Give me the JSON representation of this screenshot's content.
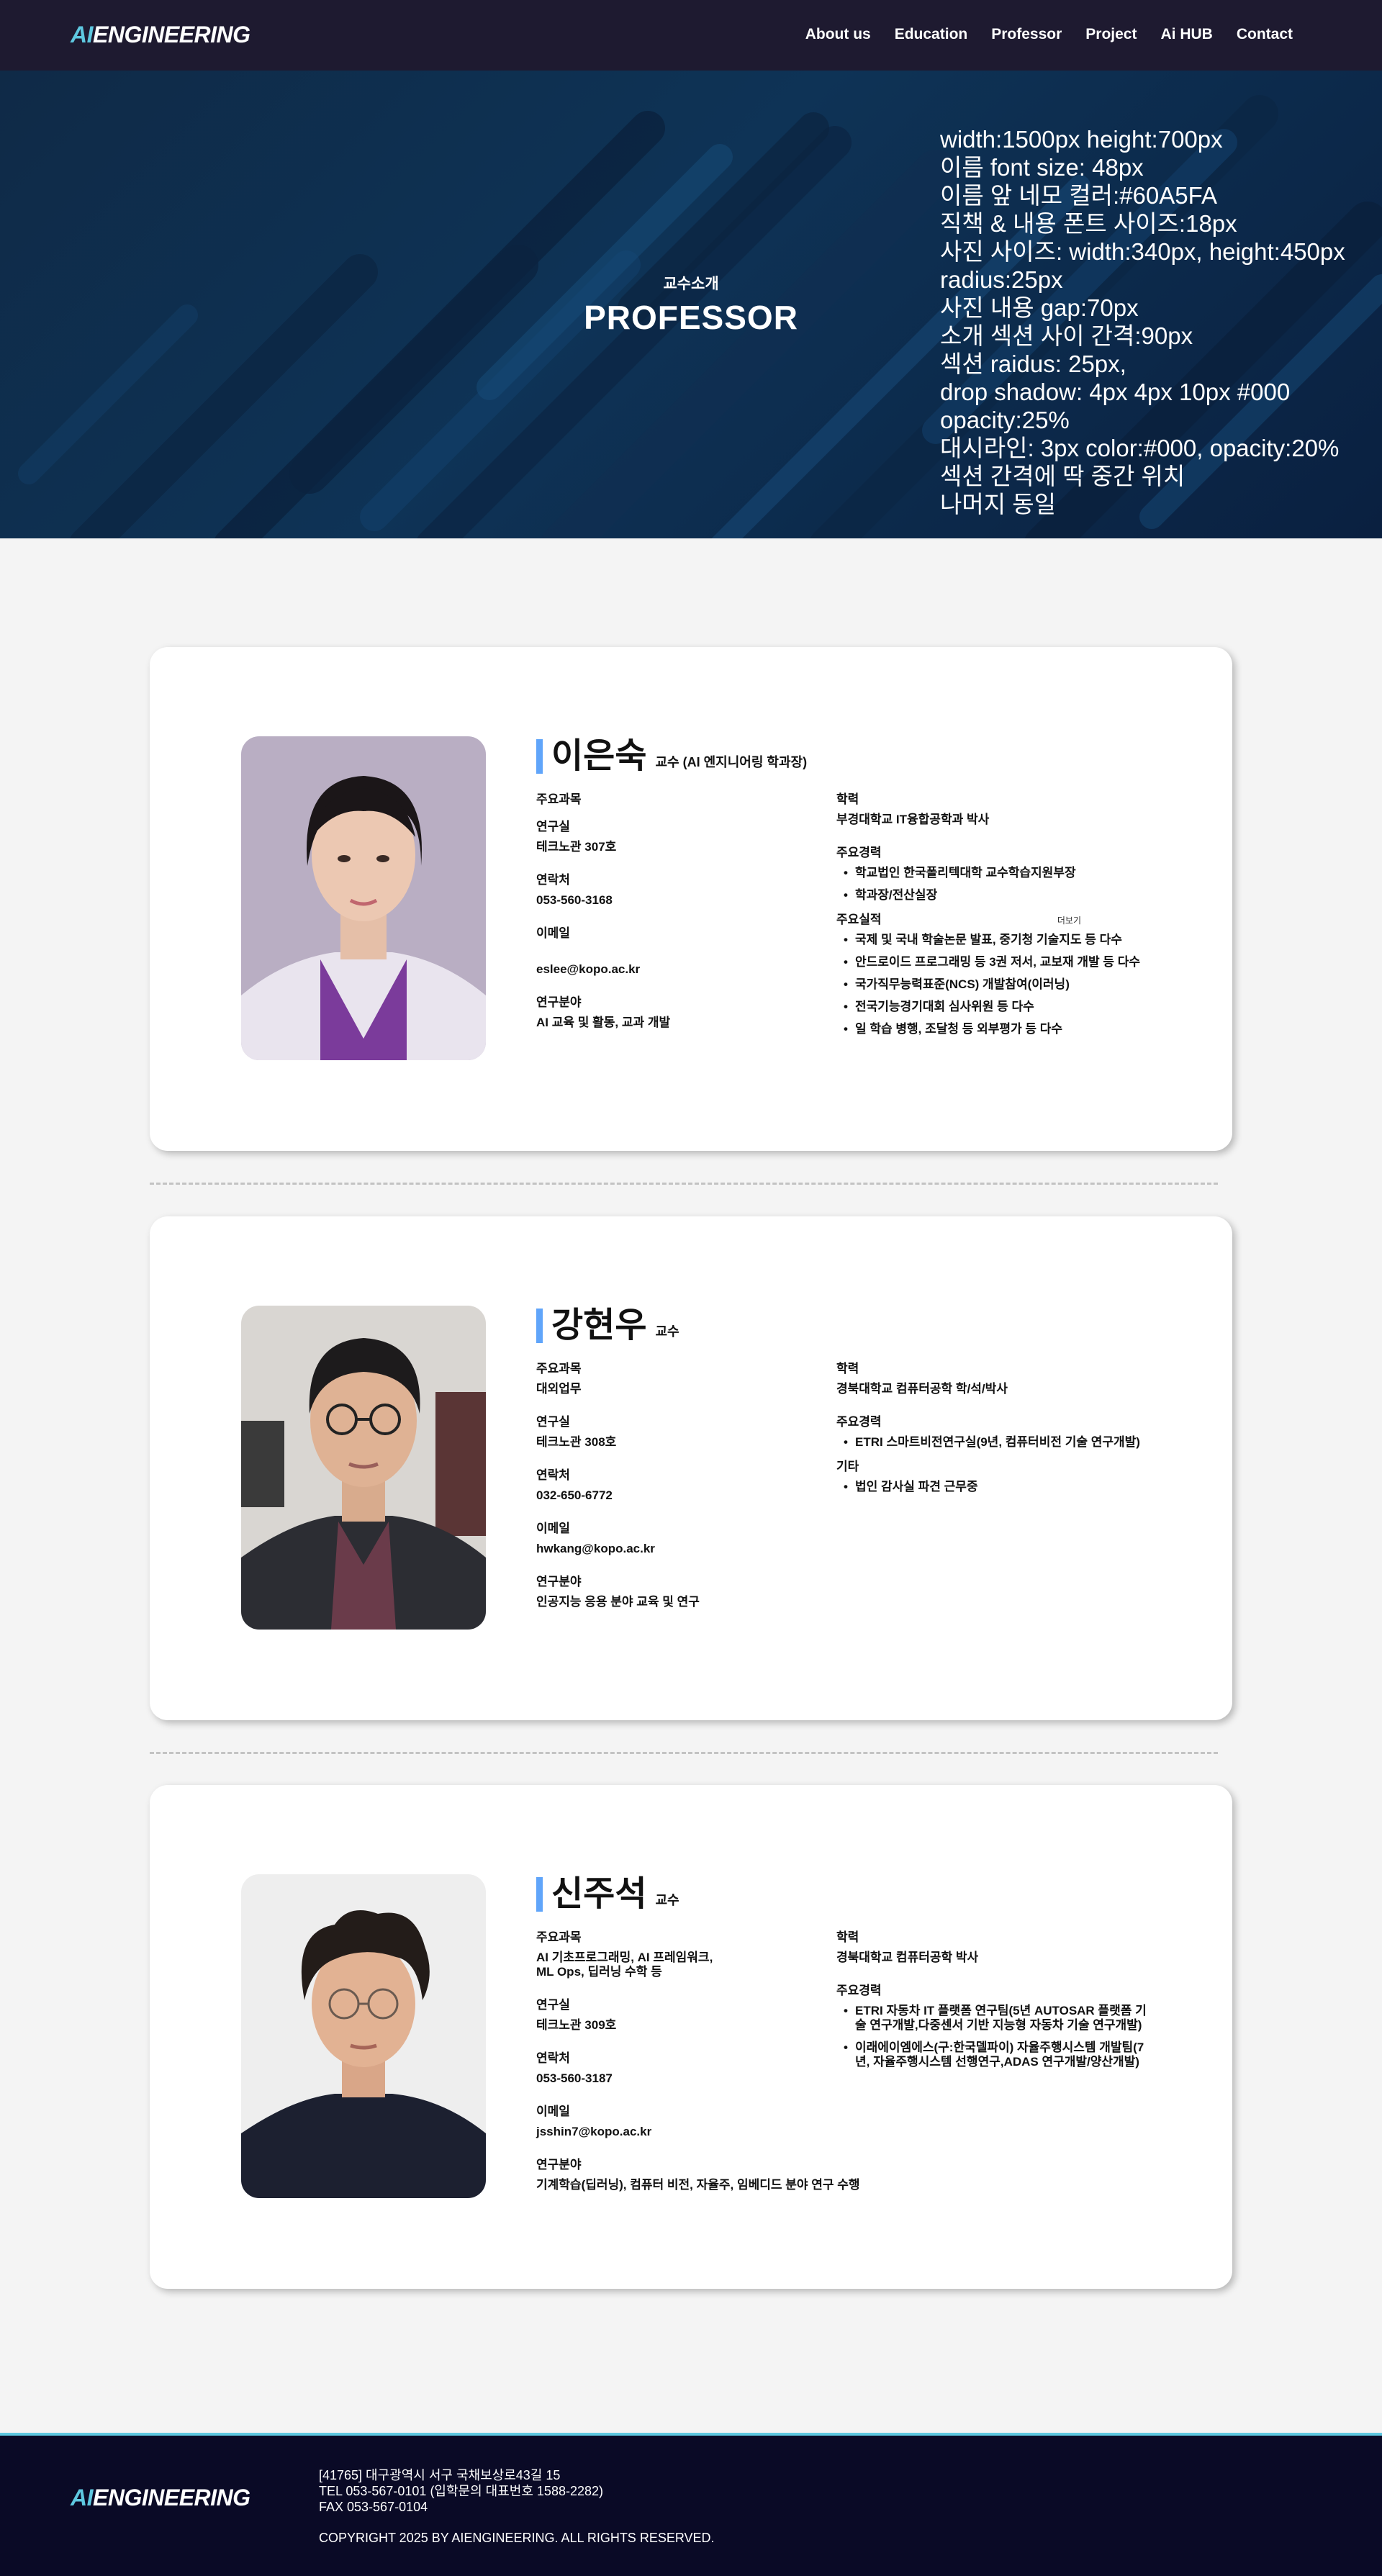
{
  "brand": {
    "logo_ai": "AI",
    "logo_rest": "ENGINEERING"
  },
  "nav": {
    "items": [
      "About us",
      "Education",
      "Professor",
      "Project",
      "Ai HUB",
      "Contact"
    ]
  },
  "hero": {
    "subtitle": "교수소개",
    "title": "PROFESSOR",
    "notes": [
      "width:1500px height:700px",
      "이름 font size: 48px",
      "이름 앞 네모 컬러:#60A5FA",
      "직책 & 내용 폰트 사이즈:18px",
      "사진 사이즈: width:340px, height:450px",
      "radius:25px",
      "사진 내용 gap:70px",
      "소개 섹션 사이 간격:90px",
      "섹션 raidus: 25px,",
      "drop shadow: 4px 4px 10px #000",
      "opacity:25%",
      "대시라인: 3px color:#000, opacity:20%",
      "섹션 간격에 딱 중간 위치",
      "나머지 동일"
    ]
  },
  "colors": {
    "accent": "#60A5FA",
    "nav_bg": "#1e1a30",
    "footer_bg": "#0a0a26",
    "logo_ai": "#5ec8e0"
  },
  "professors": [
    {
      "name": "이은숙",
      "title": "교수 (AI 엔지니어링 학과장)",
      "left": [
        {
          "label": "주요과목",
          "value": ""
        },
        {
          "label": "연구실",
          "value": "테크노관 307호"
        },
        {
          "label": "연락처",
          "value": "053-560-3168"
        },
        {
          "label": "이메일",
          "value": "eslee@kopo.ac.kr"
        },
        {
          "label": "연구분야",
          "value": "AI 교육 및 활동, 교과 개발"
        }
      ],
      "right": [
        {
          "label": "학력",
          "value": "부경대학교 IT융합공학과 박사",
          "bullets": []
        },
        {
          "label": "주요경력",
          "value": "",
          "bullets": [
            "학교법인 한국폴리텍대학 교수학습지원부장",
            "학과장/전산실장"
          ]
        },
        {
          "label": "주요실적",
          "value": "",
          "more": "더보기",
          "bullets": [
            "국제 및 국내 학술논문 발표, 중기청 기술지도 등 다수",
            "안드로이드 프로그래밍 등 3권 저서, 교보재 개발 등 다수",
            "국가직무능력표준(NCS) 개발참여(이러닝)",
            "전국기능경기대회 심사위원 등 다수",
            "일 학습 병행, 조달청 등 외부평가 등 다수"
          ]
        }
      ]
    },
    {
      "name": "강현우",
      "title": "교수",
      "left": [
        {
          "label": "주요과목",
          "value": "대외업무"
        },
        {
          "label": "연구실",
          "value": "테크노관 308호"
        },
        {
          "label": "연락처",
          "value": "032-650-6772"
        },
        {
          "label": "이메일",
          "value": "hwkang@kopo.ac.kr"
        },
        {
          "label": "연구분야",
          "value": "인공지능 응용 분야 교육 및 연구"
        }
      ],
      "right": [
        {
          "label": "학력",
          "value": "경북대학교 컴퓨터공학 학/석/박사",
          "bullets": []
        },
        {
          "label": "주요경력",
          "value": "",
          "bullets": [
            "ETRI 스마트비전연구실(9년, 컴퓨터비전 기술 연구개발)"
          ]
        },
        {
          "label": "기타",
          "value": "",
          "bullets": [
            "법인 감사실 파견 근무중"
          ]
        }
      ]
    },
    {
      "name": "신주석",
      "title": "교수",
      "left": [
        {
          "label": "주요과목",
          "value": "AI 기초프로그래밍, AI 프레임워크, ML Ops, 딥러닝 수학 등"
        },
        {
          "label": "연구실",
          "value": "테크노관 309호"
        },
        {
          "label": "연락처",
          "value": "053-560-3187"
        },
        {
          "label": "이메일",
          "value": "jsshin7@kopo.ac.kr"
        },
        {
          "label": "연구분야",
          "value": "기계학습(딥러닝), 컴퓨터 비전, 자율주, 임베디드 분야 연구 수행"
        }
      ],
      "right": [
        {
          "label": "학력",
          "value": "경북대학교 컴퓨터공학 박사",
          "bullets": []
        },
        {
          "label": "주요경력",
          "value": "",
          "bullets": [
            "ETRI 자동차 IT 플랫폼 연구팀(5년 AUTOSAR 플랫폼 기술 연구개발,다중센서 기반 지능형 자동차 기술 연구개발)",
            "이래에이엠에스(구:한국델파이) 자율주행시스템 개발팀(7년, 자율주행시스템 선행연구,ADAS 연구개발/양산개발)"
          ]
        }
      ]
    }
  ],
  "footer": {
    "address": "[41765] 대구광역시 서구 국채보상로43길 15",
    "tel": "TEL 053-567-0101  (입학문의 대표번호 1588-2282)",
    "fax": "FAX 053-567-0104",
    "copyright": "COPYRIGHT 2025 BY AIENGINEERING. ALL RIGHTS RESERVED."
  }
}
